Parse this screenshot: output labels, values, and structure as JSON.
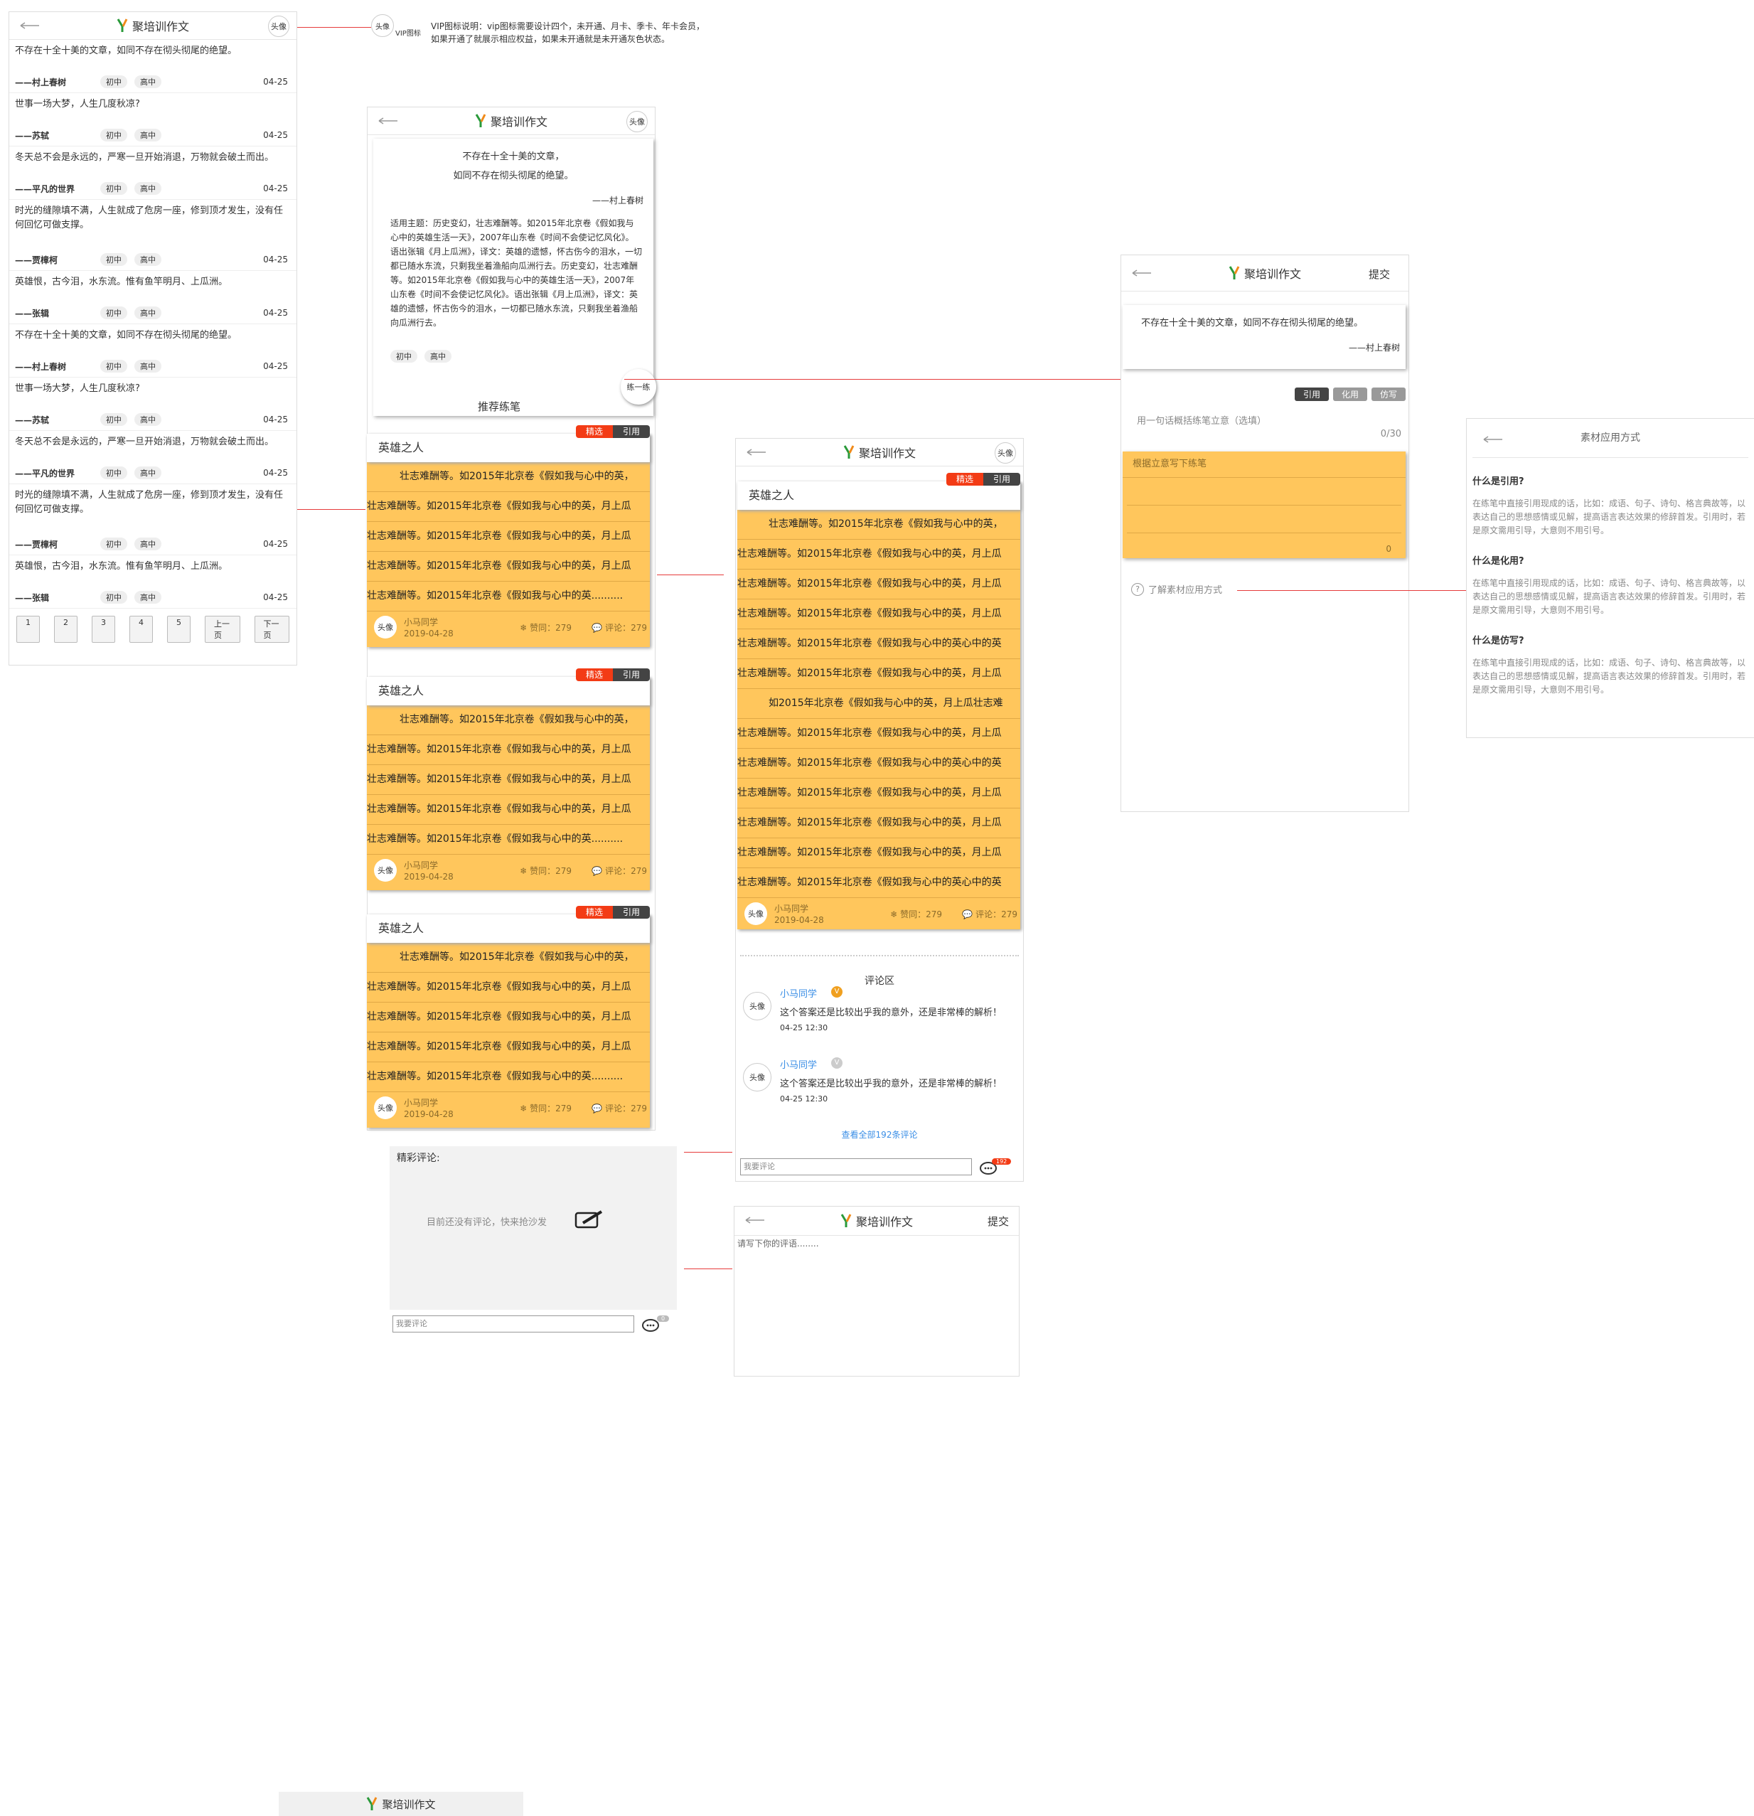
{
  "app": {
    "title": "聚培训作文",
    "avatar": "头像",
    "submit": "提交"
  },
  "annotation": {
    "avatar": "头像",
    "vip_label": "VIP图标",
    "text1": "VIP图标说明：vip图标需要设计四个，未开通、月卡、季卡、年卡会员，",
    "text2": "如果开通了就展示相应权益，如果未开通就是未开通灰色状态。"
  },
  "quote_list": [
    {
      "text": "不存在十全十美的文章，如同不存在彻头彻尾的绝望。",
      "author": "——村上春树",
      "date": "04-25"
    },
    {
      "text": "世事一场大梦，人生几度秋凉?",
      "author": "——苏轼",
      "date": "04-25"
    },
    {
      "text": "冬天总不会是永远的，严寒一旦开始消退，万物就会破土而出。",
      "author": "——平凡的世界",
      "date": "04-25"
    },
    {
      "text": "时光的缝隙填不满，人生就成了危房一座，修到顶才发生，没有任何回忆可做支撑。",
      "author": "——贾樟柯",
      "date": "04-25"
    },
    {
      "text": "英雄恨，古今泪，水东流。惟有鱼竿明月、上瓜洲。",
      "author": "——张辑",
      "date": "04-25"
    },
    {
      "text": "不存在十全十美的文章，如同不存在彻头彻尾的绝望。",
      "author": "——村上春树",
      "date": "04-25"
    },
    {
      "text": "世事一场大梦，人生几度秋凉?",
      "author": "——苏轼",
      "date": "04-25"
    },
    {
      "text": "冬天总不会是永远的，严寒一旦开始消退，万物就会破土而出。",
      "author": "——平凡的世界",
      "date": "04-25"
    },
    {
      "text": "时光的缝隙填不满，人生就成了危房一座，修到顶才发生，没有任何回忆可做支撑。",
      "author": "——贾樟柯",
      "date": "04-25"
    },
    {
      "text": "英雄恨，古今泪，水东流。惟有鱼竿明月、上瓜洲。",
      "author": "——张辑",
      "date": "04-25"
    }
  ],
  "tags": {
    "junior": "初中",
    "senior": "高中"
  },
  "pager": [
    "1",
    "2",
    "3",
    "4",
    "5",
    "上一页",
    "下一页"
  ],
  "detail": {
    "quote1": "不存在十全十美的文章，",
    "quote2": "如同不存在彻头彻尾的绝望。",
    "author": "——村上春树",
    "desc": "适用主题：历史变幻，壮志难酬等。如2015年北京卷《假如我与心中的英雄生活一天》，2007年山东卷《时间不会使记忆风化》。语出张辑《月上瓜洲》，译文：英雄的遗憾，怀古伤今的泪水，一切都已随水东流，只剩我坐着渔船向瓜洲行去。历史变幻，壮志难酬等。如2015年北京卷《假如我与心中的英雄生活一天》，2007年山东卷《时间不会使记忆风化》。语出张辑《月上瓜洲》，译文：英雄的遗憾，怀古伤今的泪水，一切都已随水东流，只剩我坐着渔船向瓜洲行去。",
    "practice": "练一练",
    "recommend": "推荐练笔"
  },
  "essay": {
    "title": "英雄之人",
    "featured": "精选",
    "cite": "引用",
    "line_first": "壮志难酬等。如2015年北京卷《假如我与心中的英，",
    "line": "壮志难酬等。如2015年北京卷《假如我与心中的英，月上瓜",
    "line_last": "壮志难酬等。如2015年北京卷《假如我与心中的英..........",
    "user": "小马同学",
    "date": "2019-04-28",
    "likes": "赞同：279",
    "comments": "评论：279"
  },
  "essay_detail": {
    "lines": [
      "壮志难酬等。如2015年北京卷《假如我与心中的英，",
      "壮志难酬等。如2015年北京卷《假如我与心中的英，月上瓜",
      "壮志难酬等。如2015年北京卷《假如我与心中的英，月上瓜",
      "壮志难酬等。如2015年北京卷《假如我与心中的英，月上瓜",
      "壮志难酬等。如2015年北京卷《假如我与心中的英心中的英",
      "壮志难酬等。如2015年北京卷《假如我与心中的英，月上瓜",
      "如2015年北京卷《假如我与心中的英，月上瓜壮志难",
      "壮志难酬等。如2015年北京卷《假如我与心中的英，月上瓜",
      "壮志难酬等。如2015年北京卷《假如我与心中的英心中的英",
      "壮志难酬等。如2015年北京卷《假如我与心中的英，月上瓜",
      "壮志难酬等。如2015年北京卷《假如我与心中的英，月上瓜",
      "壮志难酬等。如2015年北京卷《假如我与心中的英，月上瓜",
      "壮志难酬等。如2015年北京卷《假如我与心中的英心中的英"
    ],
    "comment_title": "评论区",
    "comments": [
      {
        "user": "小马同学",
        "text": "这个答案还是比较出乎我的意外，还是非常棒的解析！",
        "time": "04-25 12:30",
        "vip": "V"
      },
      {
        "user": "小马同学",
        "text": "这个答案还是比较出乎我的意外，还是非常棒的解析！",
        "time": "04-25 12:30",
        "vip": "V"
      }
    ],
    "view_all": "查看全部192条评论",
    "input_placeholder": "我要评论",
    "count": "192"
  },
  "empty_comments": {
    "title": "精彩评论:",
    "empty": "目前还没有评论，快来抢沙发",
    "input_placeholder": "我要评论",
    "count": "0"
  },
  "write_review": {
    "placeholder": "请写下你的评语........"
  },
  "practice_page": {
    "quote": "不存在十全十美的文章，如同不存在彻头彻尾的绝望。",
    "author": "——村上春树",
    "modes": [
      "引用",
      "化用",
      "仿写"
    ],
    "idea_placeholder": "用一句话概括练笔立意（选填）",
    "idea_count": "0/30",
    "body_placeholder": "根据立意写下练笔",
    "body_count": "0",
    "help": "了解素材应用方式"
  },
  "help_page": {
    "title": "素材应用方式",
    "sections": [
      {
        "q": "什么是引用?",
        "a": "在练笔中直接引用现成的话，比如：成语、句子、诗句、格言典故等，以表达自己的思想感情或见解，提高语言表达效果的修辞首发。引用时，若是原文需用引导，大意则不用引号。"
      },
      {
        "q": "什么是化用?",
        "a": "在练笔中直接引用现成的话，比如：成语、句子、诗句、格言典故等，以表达自己的思想感情或见解，提高语言表达效果的修辞首发。引用时，若是原文需用引导，大意则不用引号。"
      },
      {
        "q": "什么是仿写?",
        "a": "在练笔中直接引用现成的话，比如：成语、句子、诗句、格言典故等，以表达自己的思想感情或见解，提高语言表达效果的修辞首发。引用时，若是原文需用引导，大意则不用引号。"
      }
    ]
  },
  "colors": {
    "accent_yellow": "#ffc65c",
    "red": "#f33b15",
    "dark": "#444444",
    "link_blue": "#3a8ee6"
  }
}
